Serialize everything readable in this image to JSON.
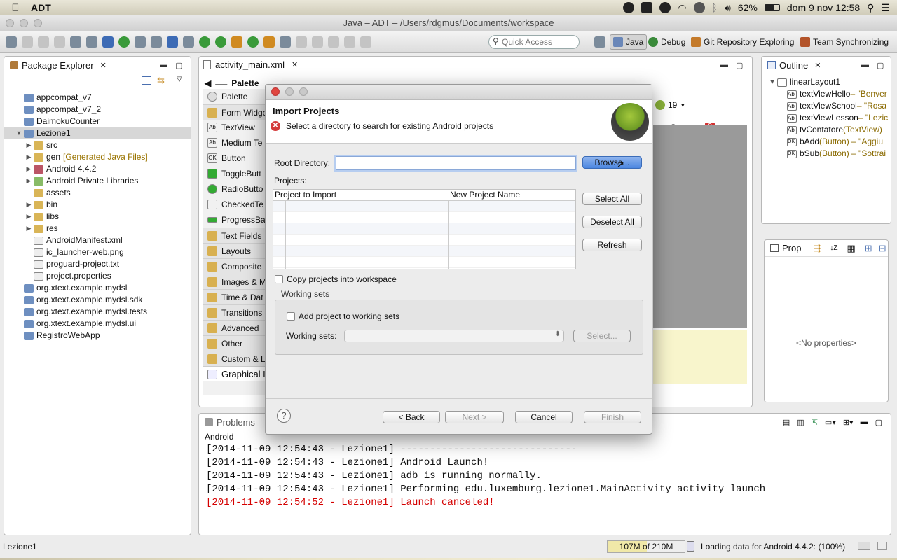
{
  "menubar": {
    "app_name": "ADT",
    "battery": "62%",
    "datetime": "dom 9 nov  12:58"
  },
  "window": {
    "title": "Java – ADT – /Users/rdgmus/Documents/workspace"
  },
  "toolbar": {
    "quick_access_placeholder": "Quick Access",
    "perspectives": [
      "Java",
      "Debug",
      "Git Repository Exploring",
      "Team Synchronizing"
    ]
  },
  "package_explorer": {
    "title": "Package Explorer",
    "items": [
      {
        "label": "appcompat_v7"
      },
      {
        "label": "appcompat_v7_2"
      },
      {
        "label": "DaimokuCounter"
      },
      {
        "label": "Lezione1"
      },
      {
        "label": "src"
      },
      {
        "label": "gen",
        "note": "[Generated Java Files]"
      },
      {
        "label": "Android 4.4.2"
      },
      {
        "label": "Android Private Libraries"
      },
      {
        "label": "assets"
      },
      {
        "label": "bin"
      },
      {
        "label": "libs"
      },
      {
        "label": "res"
      },
      {
        "label": "AndroidManifest.xml"
      },
      {
        "label": "ic_launcher-web.png"
      },
      {
        "label": "proguard-project.txt"
      },
      {
        "label": "project.properties"
      },
      {
        "label": "org.xtext.example.mydsl"
      },
      {
        "label": "org.xtext.example.mydsl.sdk"
      },
      {
        "label": "org.xtext.example.mydsl.tests"
      },
      {
        "label": "org.xtext.example.mydsl.ui"
      },
      {
        "label": "RegistroWebApp"
      }
    ]
  },
  "editor": {
    "tab_label": "activity_main.xml",
    "palette_header": "Palette",
    "palette_title": "Palette",
    "api_level": "19",
    "error_count": "3",
    "palette_items": [
      {
        "label": "Form Widge",
        "icon": "folder-icon",
        "category": true
      },
      {
        "label": "TextView",
        "icon": "Ab"
      },
      {
        "label": "Medium Te",
        "icon": "Ab"
      },
      {
        "label": "Button",
        "icon": "OK"
      },
      {
        "label": "ToggleButt",
        "icon": "toggle-icon"
      },
      {
        "label": "RadioButto",
        "icon": "radio-icon"
      },
      {
        "label": "CheckedTe",
        "icon": "check-icon"
      },
      {
        "label": "ProgressBa",
        "icon": "progress-icon"
      },
      {
        "label": "Text Fields",
        "icon": "folder-icon",
        "category": true
      },
      {
        "label": "Layouts",
        "icon": "folder-icon",
        "category": true
      },
      {
        "label": "Composite",
        "icon": "folder-icon",
        "category": true
      },
      {
        "label": "Images & M",
        "icon": "folder-icon",
        "category": true
      },
      {
        "label": "Time & Dat",
        "icon": "folder-icon",
        "category": true
      },
      {
        "label": "Transitions",
        "icon": "folder-icon",
        "category": true
      },
      {
        "label": "Advanced",
        "icon": "folder-icon",
        "category": true
      },
      {
        "label": "Other",
        "icon": "folder-icon",
        "category": true
      },
      {
        "label": "Custom & L",
        "icon": "folder-icon",
        "category": true
      }
    ],
    "bottom_tab": "Graphical L"
  },
  "outline": {
    "title": "Outline",
    "items": [
      {
        "name": "linearLayout1",
        "detail": ""
      },
      {
        "name": "textViewHello",
        "detail": " – \"Benver"
      },
      {
        "name": "textViewSchool",
        "detail": " – \"Rosa"
      },
      {
        "name": "textViewLesson",
        "detail": " – \"Lezic"
      },
      {
        "name": "tvContatore",
        "detail": " (TextView)"
      },
      {
        "name": "bAdd",
        "detail": " (Button) – \"Aggiu"
      },
      {
        "name": "bSub",
        "detail": " (Button) – \"Sottrai"
      }
    ]
  },
  "properties": {
    "title": "Prop",
    "empty_text": "<No properties>"
  },
  "console": {
    "tab_label": "Problems",
    "section": "Android",
    "lines": [
      {
        "text": "[2014-11-09 12:54:43 - Lezione1] ------------------------------",
        "error": false
      },
      {
        "text": "[2014-11-09 12:54:43 - Lezione1] Android Launch!",
        "error": false
      },
      {
        "text": "[2014-11-09 12:54:43 - Lezione1] adb is running normally.",
        "error": false
      },
      {
        "text": "[2014-11-09 12:54:43 - Lezione1] Performing edu.luxemburg.lezione1.MainActivity activity launch",
        "error": false
      },
      {
        "text": "[2014-11-09 12:54:52 - Lezione1] Launch canceled!",
        "error": true
      }
    ]
  },
  "status": {
    "selection": "Lezione1",
    "memory": "107M of 210M",
    "memory_used_fraction": 0.51,
    "loading": "Loading data for Android 4.4.2: (100%)"
  },
  "dialog": {
    "title": "Import Projects",
    "message": "Select a directory to search for existing Android projects",
    "root_directory_label": "Root Directory:",
    "root_directory_value": "",
    "browse_label": "Browse...",
    "projects_label": "Projects:",
    "columns": [
      "Project to Import",
      "New Project Name"
    ],
    "select_all_label": "Select All",
    "deselect_all_label": "Deselect All",
    "refresh_label": "Refresh",
    "copy_label": "Copy projects into workspace",
    "working_sets_group": "Working sets",
    "add_to_ws_label": "Add project to working sets",
    "working_sets_label": "Working sets:",
    "select_ws_label": "Select...",
    "back_label": "< Back",
    "next_label": "Next >",
    "cancel_label": "Cancel",
    "finish_label": "Finish"
  }
}
